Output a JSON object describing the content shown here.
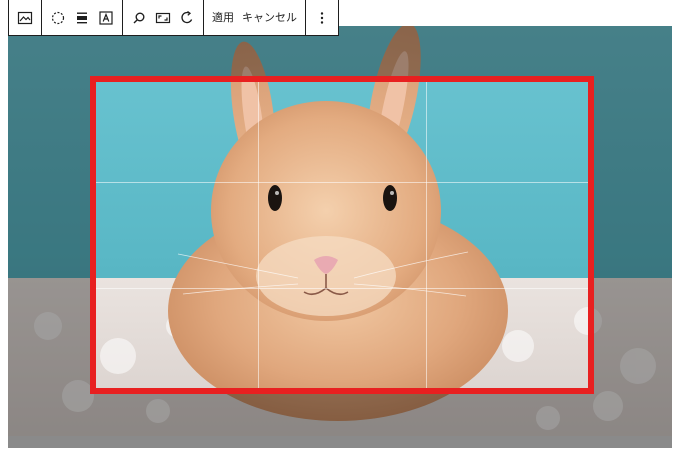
{
  "toolbar": {
    "groups": [
      {
        "items": [
          {
            "icon": "image-icon"
          }
        ]
      },
      {
        "items": [
          {
            "icon": "dashed-circle-icon"
          },
          {
            "icon": "align-icon"
          },
          {
            "icon": "text-overlay-icon"
          }
        ]
      },
      {
        "items": [
          {
            "icon": "zoom-icon"
          },
          {
            "icon": "aspect-ratio-icon"
          },
          {
            "icon": "rotate-icon"
          }
        ]
      }
    ],
    "apply_label": "適用",
    "cancel_label": "キャンセル",
    "more_icon": "more-vertical-icon"
  },
  "image": {
    "subject": "rabbit",
    "crop_grid": "3x3",
    "crop_border_color": "#e82020"
  },
  "colors": {
    "crop_border": "#e82020",
    "toolbar_border": "#1e1e1e",
    "backdrop": "#5fbcc8"
  }
}
